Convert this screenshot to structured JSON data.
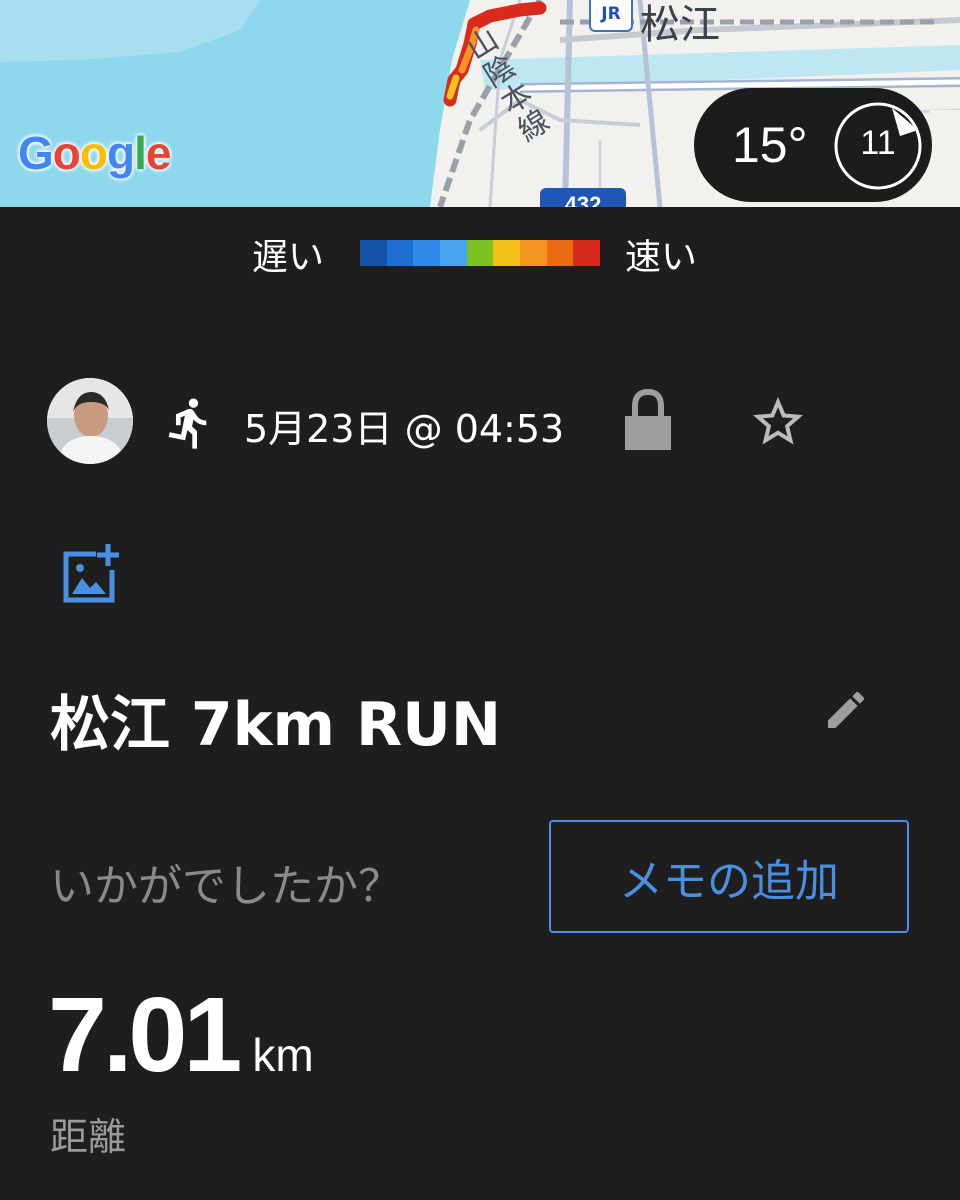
{
  "map": {
    "station_name": "松江",
    "jr_badge": "JR",
    "rail_line": "山陰本線",
    "route_number": "432",
    "provider": [
      "G",
      "o",
      "o",
      "g",
      "l",
      "e"
    ],
    "provider_colors": [
      "#4285F4",
      "#EA4335",
      "#FBBC05",
      "#4285F4",
      "#34A853",
      "#EA4335"
    ],
    "water_color": "#8ed8ee"
  },
  "weather": {
    "temperature": "15°",
    "wind_speed": "11"
  },
  "pace_legend": {
    "slow_label": "遅い",
    "fast_label": "速い",
    "colors": [
      "#1452a8",
      "#1e6fd1",
      "#2f8ae8",
      "#4aa3ef",
      "#7fc122",
      "#f2c21a",
      "#f39423",
      "#e96c12",
      "#d82a1f"
    ]
  },
  "activity": {
    "date_time": "5月23日 @ 04:53",
    "title": "松江 7km RUN",
    "prompt": "いかがでしたか？",
    "add_memo_label": "メモの追加",
    "distance_value": "7.01",
    "distance_unit": "km",
    "distance_label": "距離"
  }
}
